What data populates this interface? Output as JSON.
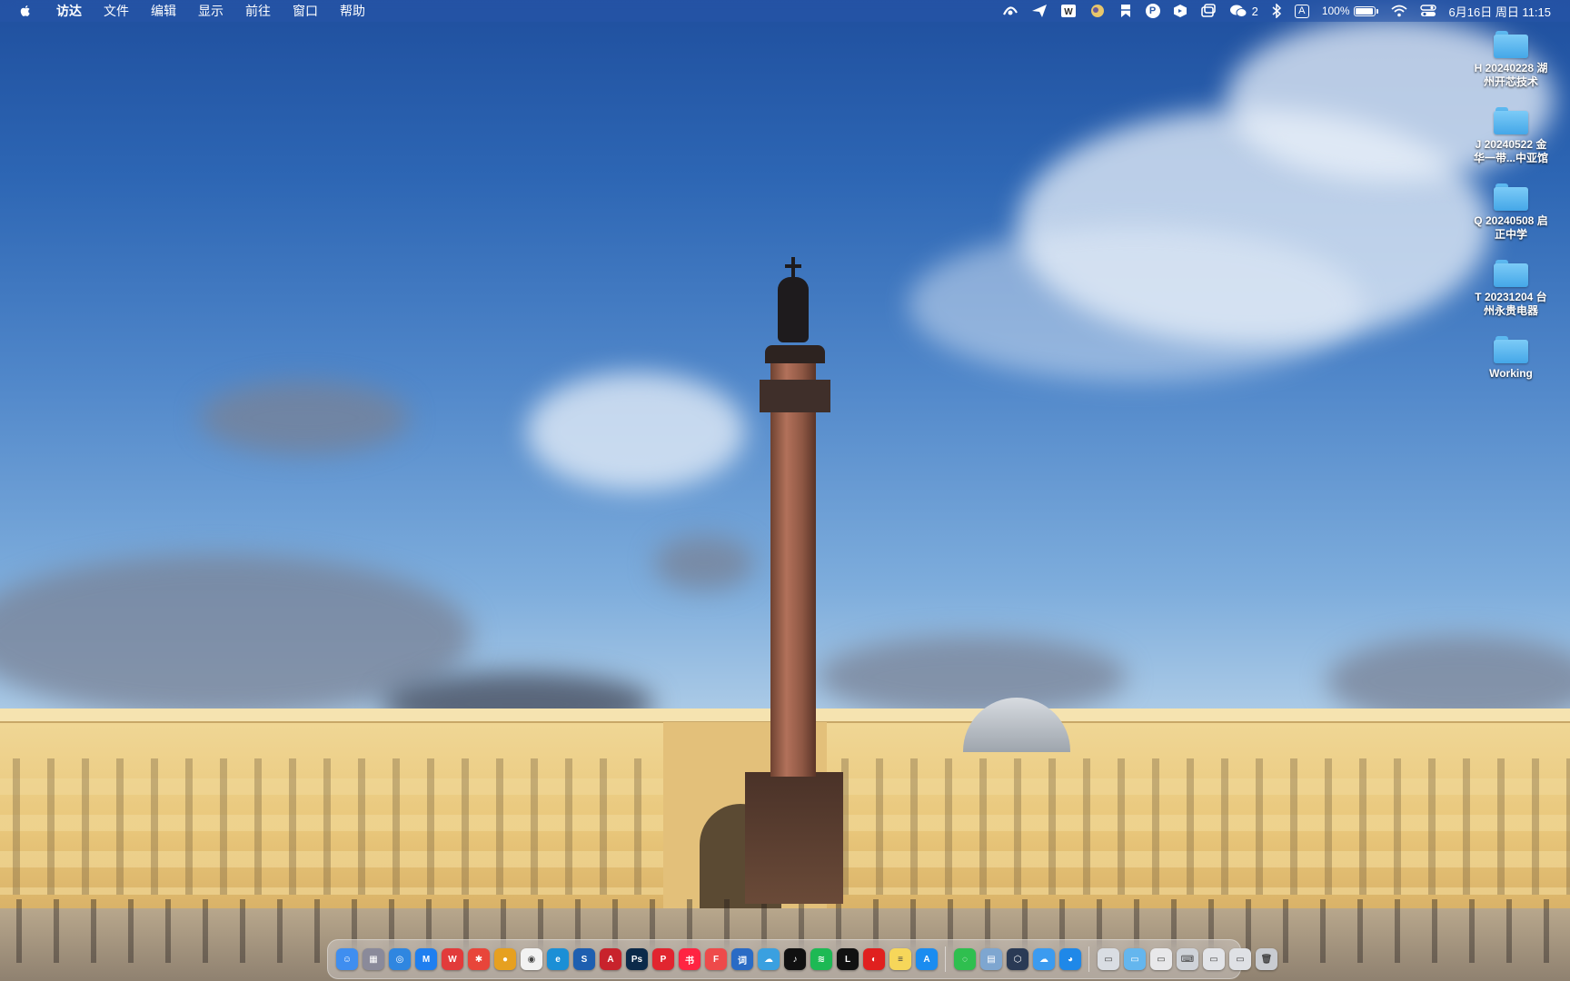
{
  "menubar": {
    "app_name": "访达",
    "menus": [
      "文件",
      "编辑",
      "显示",
      "前往",
      "窗口",
      "帮助"
    ],
    "status_icons": [
      "drive-icon",
      "send-icon",
      "wps-icon",
      "globe-icon",
      "bookmark-icon",
      "p-icon",
      "shield-icon",
      "window-icon"
    ],
    "wechat_count": "2",
    "input_method": "A",
    "battery_percent": "100%",
    "battery_level": 1.0,
    "datetime": "6月16日 周日 11:15"
  },
  "desktop": {
    "items": [
      {
        "line1": "H 20240228 湖",
        "line2": "州开芯技术"
      },
      {
        "line1": "J 20240522 金",
        "line2": "华一带...中亚馆"
      },
      {
        "line1": "Q 20240508 启",
        "line2": "正中学"
      },
      {
        "line1": "T 20231204 台",
        "line2": "州永贵电器"
      },
      {
        "line1": "Working",
        "line2": ""
      }
    ]
  },
  "dock": {
    "apps": [
      {
        "icon": "finder-icon",
        "color": "#3f8ef0",
        "glyph": "☺"
      },
      {
        "icon": "launchpad-icon",
        "color": "#8a8a9a",
        "glyph": "▦"
      },
      {
        "icon": "safari-icon",
        "color": "#2f86e0",
        "glyph": "◎"
      },
      {
        "icon": "lanhu-icon",
        "color": "#1f7ff0",
        "glyph": "M"
      },
      {
        "icon": "wps-icon",
        "color": "#e23b3b",
        "glyph": "W"
      },
      {
        "icon": "xmind-icon",
        "color": "#e8453a",
        "glyph": "✱"
      },
      {
        "icon": "color-wheel-icon",
        "color": "#e6a020",
        "glyph": "●"
      },
      {
        "icon": "chrome-icon",
        "color": "#f2f2f2",
        "glyph": "◉"
      },
      {
        "icon": "edge-icon",
        "color": "#1b8fd6",
        "glyph": "e"
      },
      {
        "icon": "scrypt-icon",
        "color": "#1e5fb0",
        "glyph": "S"
      },
      {
        "icon": "acrobat-icon",
        "color": "#c8232c",
        "glyph": "A"
      },
      {
        "icon": "photoshop-icon",
        "color": "#0b2a4a",
        "glyph": "Ps"
      },
      {
        "icon": "pinterest-icon",
        "color": "#e1252f",
        "glyph": "P"
      },
      {
        "icon": "xiaohongshu-icon",
        "color": "#ff2442",
        "glyph": "书"
      },
      {
        "icon": "fonts-icon",
        "color": "#ee4a4a",
        "glyph": "F"
      },
      {
        "icon": "dict-icon",
        "color": "#2a6bc5",
        "glyph": "词"
      },
      {
        "icon": "cloud-drive-icon",
        "color": "#3aa0e0",
        "glyph": "☁"
      },
      {
        "icon": "tiktok-icon",
        "color": "#111111",
        "glyph": "♪"
      },
      {
        "icon": "spotify-icon",
        "color": "#1db954",
        "glyph": "≋"
      },
      {
        "icon": "l-app-icon",
        "color": "#111111",
        "glyph": "L"
      },
      {
        "icon": "netease-music-icon",
        "color": "#e0201f",
        "glyph": "◐"
      },
      {
        "icon": "notes-icon",
        "color": "#f6d65a",
        "glyph": "≡"
      },
      {
        "icon": "app-store-icon",
        "color": "#1a8cf0",
        "glyph": "A"
      },
      {
        "icon": "wechat-icon",
        "color": "#2fbf4f",
        "glyph": "◌"
      },
      {
        "icon": "preview-icon",
        "color": "#7ea6d0",
        "glyph": "▤"
      },
      {
        "icon": "hexagon-app-icon",
        "color": "#2a3a55",
        "glyph": "⬡"
      },
      {
        "icon": "baidu-netdisk-icon",
        "color": "#3b9bf0",
        "glyph": "☁"
      },
      {
        "icon": "qq-browser-icon",
        "color": "#1f88e8",
        "glyph": "◕"
      }
    ],
    "folders": [
      {
        "icon": "downloads-stack-icon",
        "color": "#d9dde3",
        "glyph": "▭"
      },
      {
        "icon": "folder-stack-icon",
        "color": "#64b6ee",
        "glyph": "▭"
      },
      {
        "icon": "documents-stack-icon",
        "color": "#e8e8ea",
        "glyph": "▭"
      },
      {
        "icon": "keyboard-stack-icon",
        "color": "#cfd3d9",
        "glyph": "⌨"
      },
      {
        "icon": "files-stack-icon",
        "color": "#e2e4e8",
        "glyph": "▭"
      },
      {
        "icon": "screenshots-stack-icon",
        "color": "#dfe1e5",
        "glyph": "▭"
      },
      {
        "icon": "trash-icon",
        "color": "#c9ccd1",
        "glyph": "🗑"
      }
    ]
  }
}
